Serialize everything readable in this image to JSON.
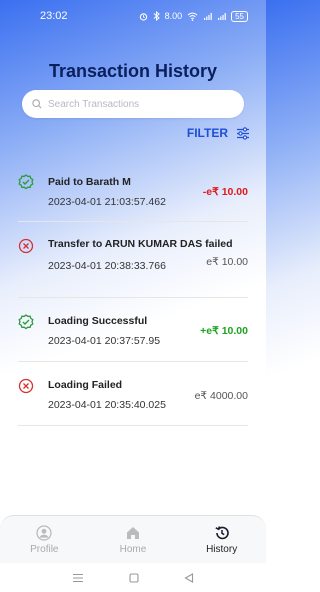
{
  "status_bar": {
    "time": "23:02",
    "icons": [
      "alarm-icon",
      "bluetooth-icon",
      "data-speed",
      "wifi-icon",
      "signal-icon",
      "signal-icon",
      "battery-icon"
    ],
    "data_speed": "8.00",
    "battery": "55"
  },
  "page": {
    "title": "Transaction History"
  },
  "search": {
    "placeholder": "Search Transactions",
    "icon": "search-icon"
  },
  "filter": {
    "label": "FILTER",
    "icon": "sliders-icon"
  },
  "transactions": [
    {
      "name": "Paid to Barath M",
      "timestamp": "2023-04-01 21:03:57.462",
      "amount": "-e₹ 10.00",
      "status": "success",
      "icon": "check-badge-icon"
    },
    {
      "name": "Transfer to ARUN KUMAR DAS failed",
      "timestamp": "2023-04-01 20:38:33.766",
      "amount": "e₹ 10.00",
      "status": "failed",
      "icon": "error-circle-icon"
    },
    {
      "name": "Loading Successful",
      "timestamp": "2023-04-01 20:37:57.95",
      "amount": "+e₹ 10.00",
      "status": "success",
      "icon": "check-badge-icon"
    },
    {
      "name": "Loading Failed",
      "timestamp": "2023-04-01 20:35:40.025",
      "amount": "e₹ 4000.00",
      "status": "failed",
      "icon": "error-circle-icon"
    }
  ],
  "bottom_nav": [
    {
      "label": "Profile",
      "icon": "profile-icon",
      "active": false
    },
    {
      "label": "Home",
      "icon": "home-icon",
      "active": false
    },
    {
      "label": "History",
      "icon": "history-icon",
      "active": true
    }
  ],
  "colors": {
    "accent": "#1f4fd6",
    "title": "#0b1f5c",
    "debit": "#e01818",
    "credit": "#1fa31f",
    "success_icon": "#2e9b3a",
    "failed_icon": "#d63030"
  }
}
